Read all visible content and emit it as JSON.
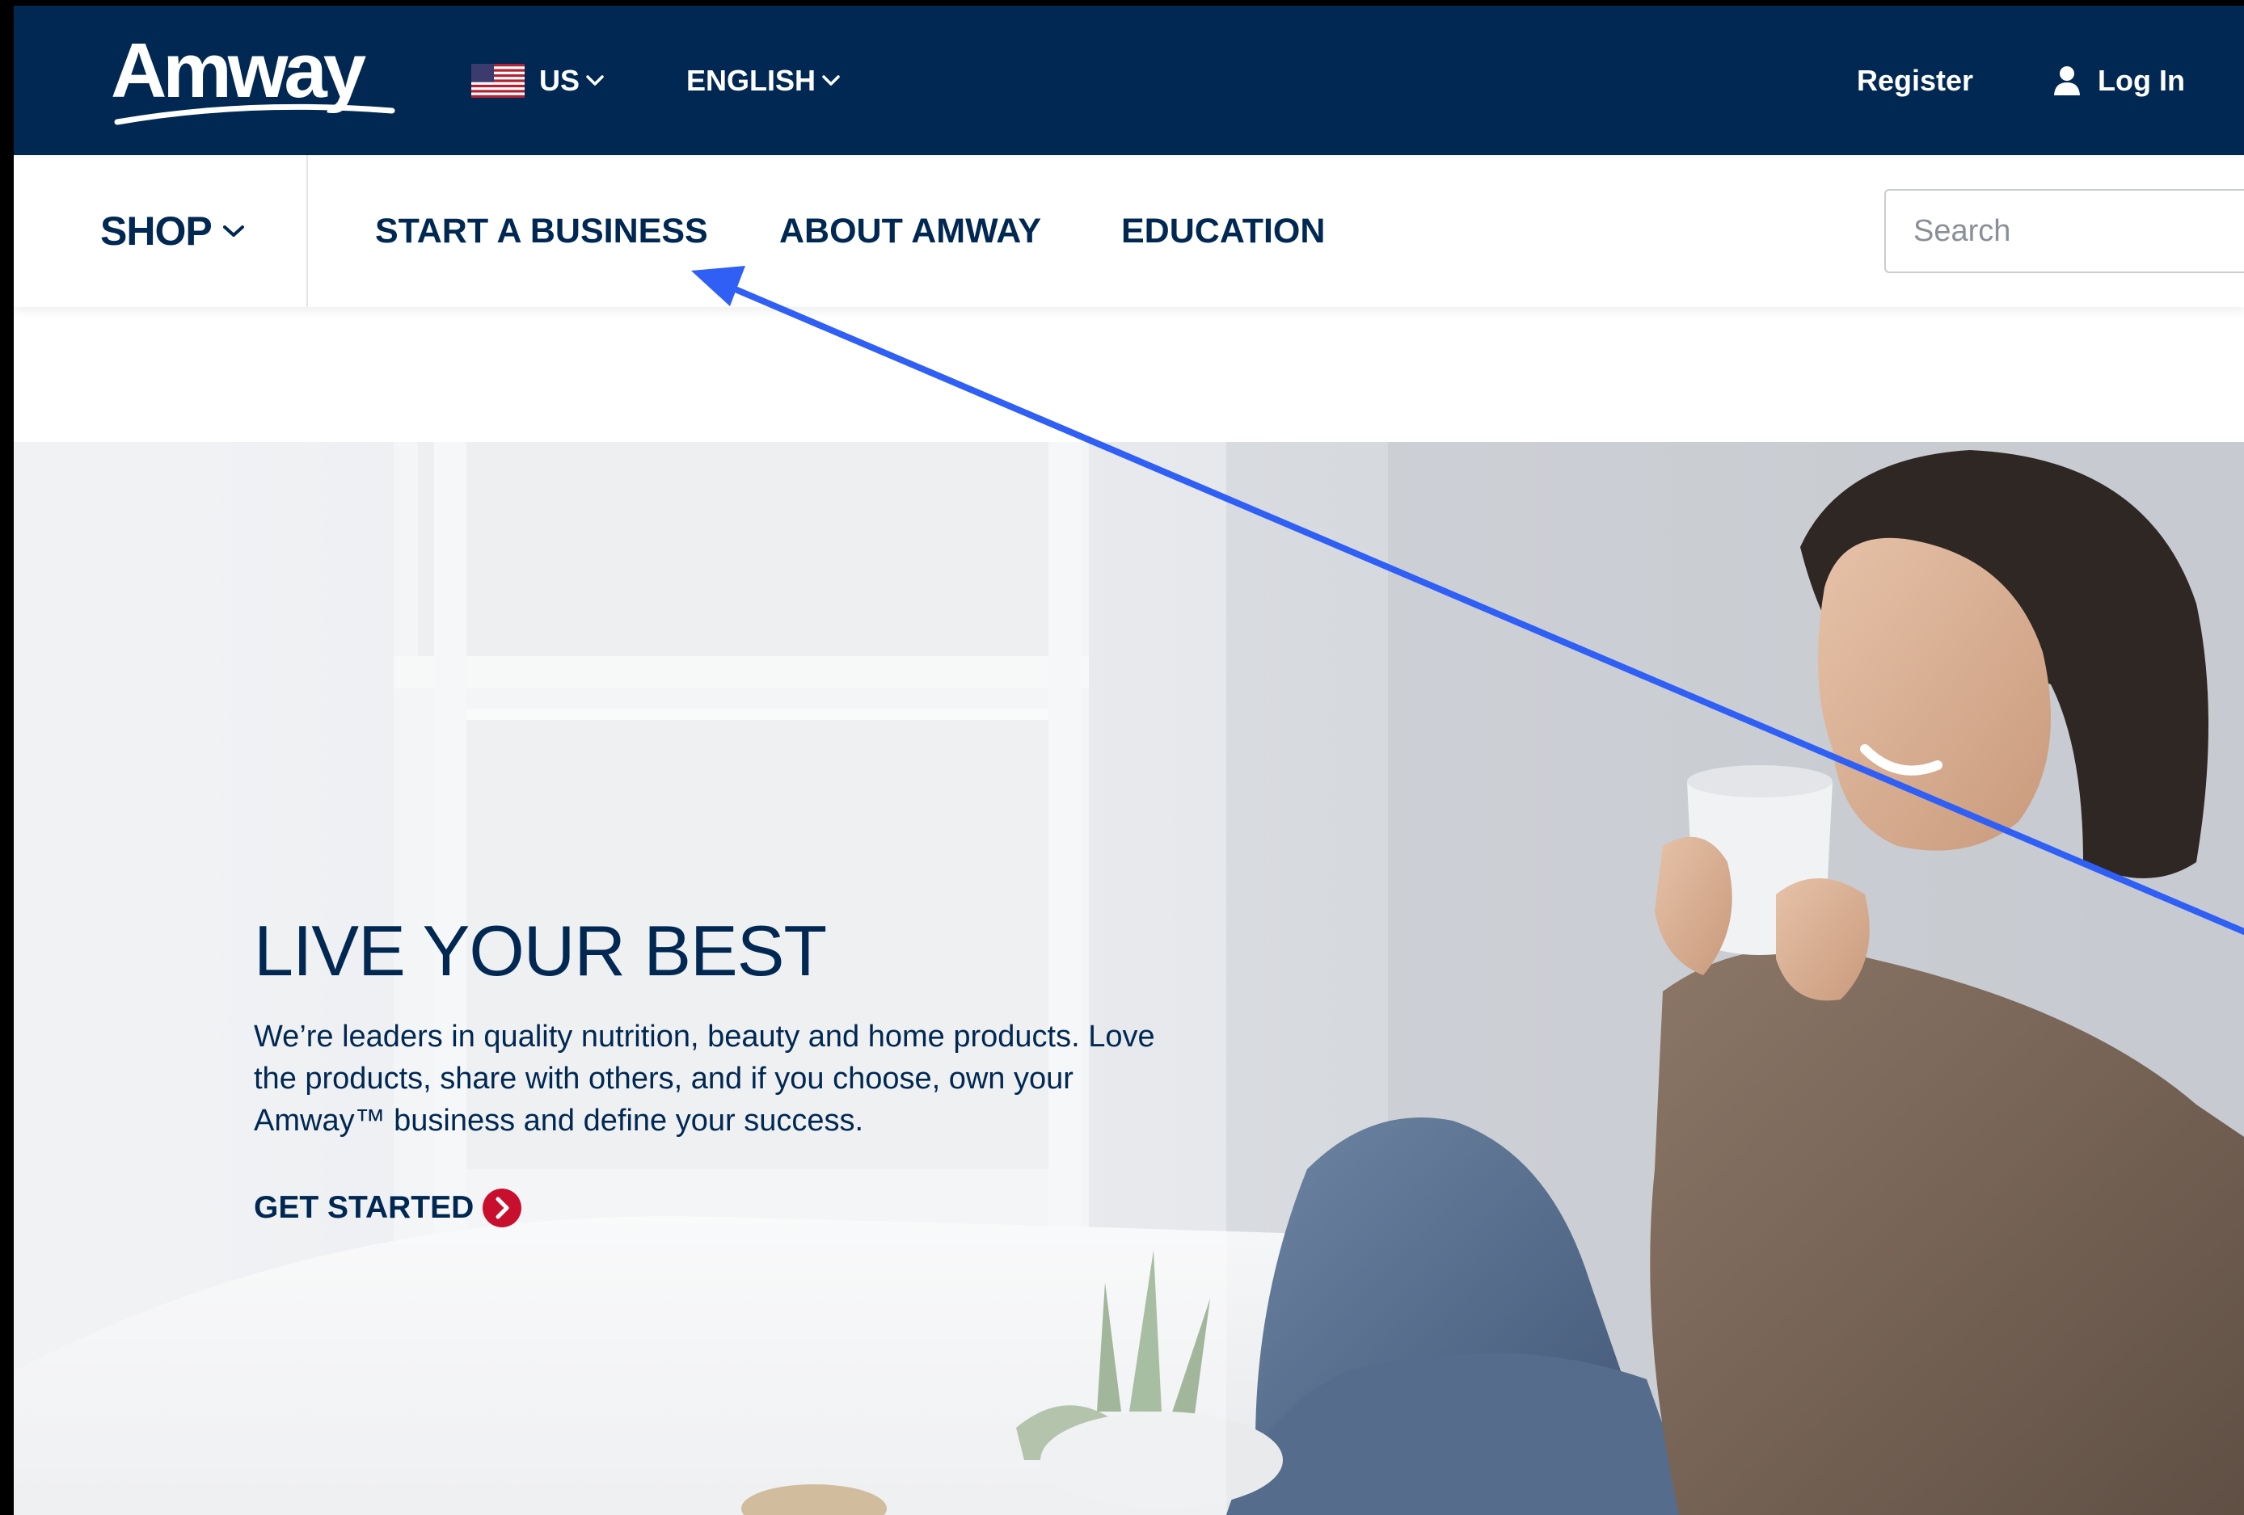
{
  "brand": {
    "logo_text": "Amway",
    "colors": {
      "navy": "#002852",
      "white": "#ffffff",
      "cta_red": "#c8102e",
      "annotation_blue": "#2f5ff5"
    }
  },
  "topbar": {
    "country": {
      "label": "US",
      "flag_icon": "us-flag-icon"
    },
    "language": {
      "label": "ENGLISH"
    },
    "register_label": "Register",
    "login_label": "Log In"
  },
  "nav": {
    "shop_label": "SHOP",
    "items": [
      {
        "label": "START A BUSINESS"
      },
      {
        "label": "ABOUT AMWAY"
      },
      {
        "label": "EDUCATION"
      }
    ],
    "search_placeholder": "Search"
  },
  "hero": {
    "title": "LIVE YOUR BEST",
    "body": "We’re leaders in quality nutrition, beauty and home products. Love the products, share with others, and if you choose, own your Amway™ business and define your success.",
    "cta_label": "GET STARTED"
  },
  "annotation": {
    "type": "arrow",
    "target": "START A BUSINESS"
  }
}
